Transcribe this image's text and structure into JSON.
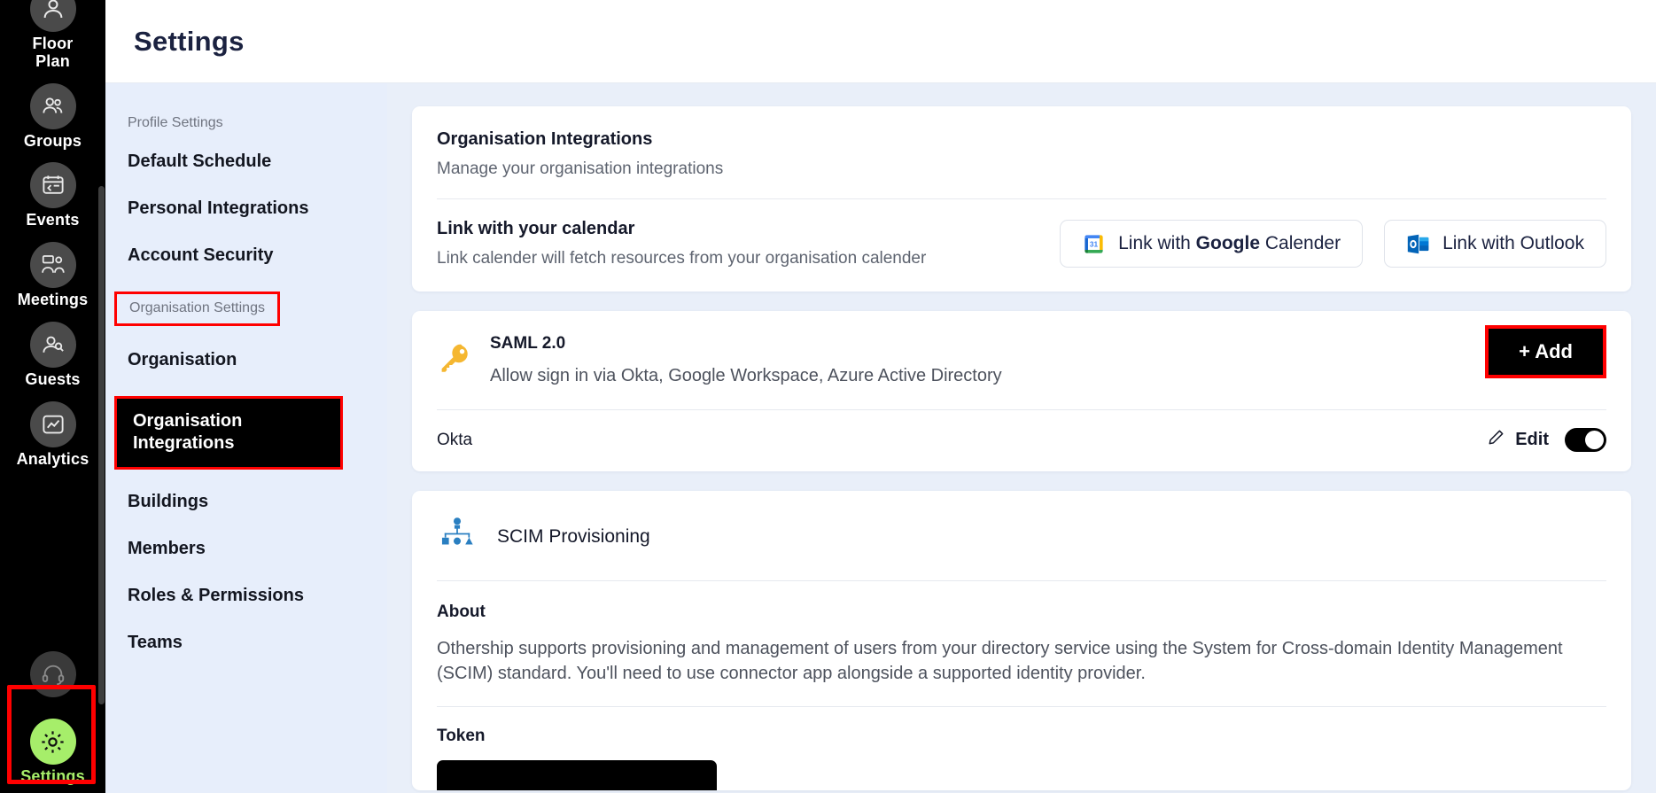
{
  "header": {
    "title": "Settings"
  },
  "rail": {
    "items": [
      {
        "label": "Floor\nPlan",
        "icon": "user-icon",
        "name": "floor-plan"
      },
      {
        "label": "Groups",
        "icon": "groups-icon",
        "name": "groups"
      },
      {
        "label": "Events",
        "icon": "calendar-icon",
        "name": "events"
      },
      {
        "label": "Meetings",
        "icon": "meetings-icon",
        "name": "meetings"
      },
      {
        "label": "Guests",
        "icon": "guest-icon",
        "name": "guests"
      },
      {
        "label": "Analytics",
        "icon": "chart-line-icon",
        "name": "analytics"
      }
    ],
    "support": {
      "label": "",
      "icon": "headset-icon"
    },
    "settings": {
      "label": "Settings",
      "icon": "gear-icon"
    },
    "active_label": "Settings",
    "active_color": "#a6ee6a",
    "highlight_color": "#ff0000"
  },
  "settings_nav": {
    "profile_group_label": "Profile Settings",
    "profile_items": [
      "Default Schedule",
      "Personal Integrations",
      "Account Security"
    ],
    "org_group_label": "Organisation Settings",
    "org_items_before": [
      "Organisation"
    ],
    "selected_item": "Organisation Integrations",
    "org_items_after": [
      "Buildings",
      "Members",
      "Roles & Permissions",
      "Teams"
    ]
  },
  "integrations_card": {
    "title": "Organisation Integrations",
    "subtitle": "Manage your organisation integrations",
    "calendar_heading": "Link with your calendar",
    "calendar_description": "Link calender will fetch resources from your organisation calender",
    "google_button": {
      "prefix": "Link with ",
      "brand": "Google",
      "suffix": " Calender",
      "icon": "google-calendar-icon"
    },
    "outlook_button": {
      "label": "Link with Outlook",
      "icon": "outlook-icon"
    }
  },
  "saml_card": {
    "icon": "key-icon",
    "title": "SAML 2.0",
    "description": "Allow sign in via Okta, Google Workspace, Azure Active Directory",
    "add_button": "+ Add",
    "provider_name": "Okta",
    "edit_label": "Edit",
    "edit_icon": "pencil-icon",
    "toggle_state": "on"
  },
  "scim_card": {
    "icon": "scim-org-chart-icon",
    "title": "SCIM Provisioning",
    "about_heading": "About",
    "about_text": "Othership supports provisioning and management of users from your directory service using the System for Cross-domain Identity Management (SCIM) standard. You'll need to use connector app alongside a supported identity provider.",
    "token_heading": "Token"
  }
}
